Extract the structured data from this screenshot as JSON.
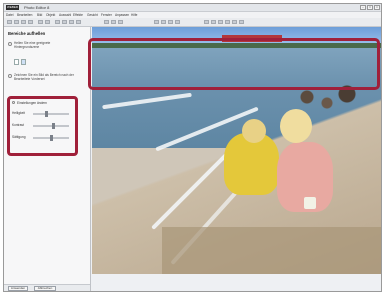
{
  "window": {
    "logo": "WEBER",
    "title": "Photo Editor 8"
  },
  "menu": {
    "items": [
      "Datei",
      "Bearbeiten",
      "Bild",
      "Objekt",
      "Auswahl",
      "Effekte",
      "Gesicht",
      "Fenster",
      "Anpassen",
      "Hilfe"
    ]
  },
  "sidebar": {
    "title": "Bereiche aufhellen",
    "option1": "Hellen Sie eine geeignete Hintergrundszene",
    "option2": "Zeichnen Sie ein Bild als Bereich nach der Bearbeitete Vordersei",
    "settings": {
      "header": "Einstellungen ändern",
      "sliders": [
        {
          "label": "Helligkeit",
          "value": 0.35
        },
        {
          "label": "Kontrast",
          "value": 0.55
        },
        {
          "label": "Sättigung",
          "value": 0.5
        }
      ]
    },
    "buttons": {
      "apply": "Anwenden",
      "cancel": "Abbrechen"
    }
  },
  "colors": {
    "highlight": "#a0203a"
  }
}
